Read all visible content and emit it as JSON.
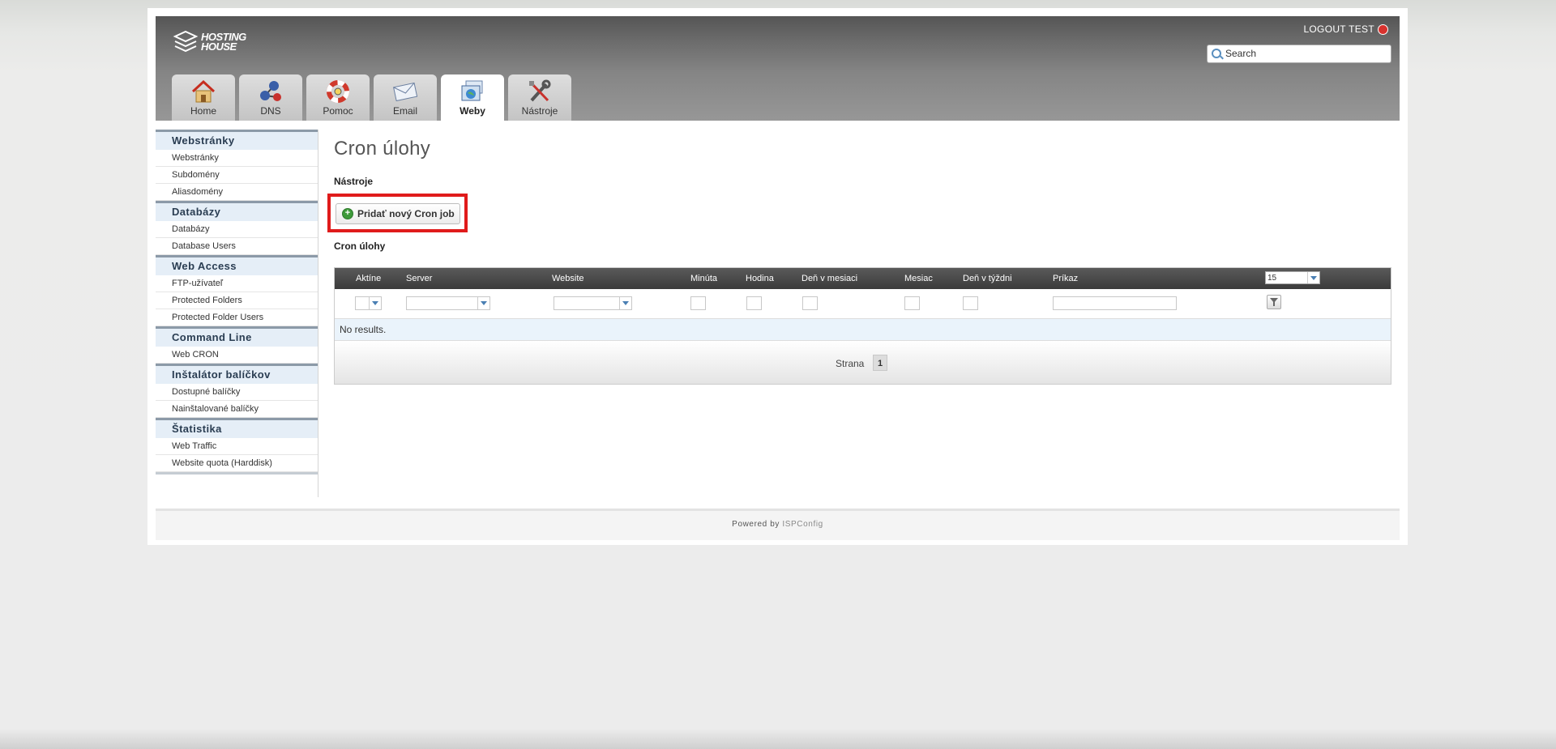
{
  "header": {
    "logo_text_line1": "HOSTING",
    "logo_text_line2": "HOUSE",
    "logout_label": "LOGOUT TEST",
    "search_placeholder": "Search"
  },
  "tabs": [
    {
      "label": "Home",
      "icon": "home-icon"
    },
    {
      "label": "DNS",
      "icon": "dns-icon"
    },
    {
      "label": "Pomoc",
      "icon": "lifebuoy-icon"
    },
    {
      "label": "Email",
      "icon": "envelope-icon"
    },
    {
      "label": "Weby",
      "icon": "globe-icon",
      "active": true
    },
    {
      "label": "Nástroje",
      "icon": "tools-icon"
    }
  ],
  "sidebar": {
    "sections": [
      {
        "title": "Webstránky",
        "items": [
          "Webstránky",
          "Subdomény",
          "Aliasdomény"
        ]
      },
      {
        "title": "Databázy",
        "items": [
          "Databázy",
          "Database Users"
        ]
      },
      {
        "title": "Web Access",
        "items": [
          "FTP-užívateľ",
          "Protected Folders",
          "Protected Folder Users"
        ]
      },
      {
        "title": "Command Line",
        "items": [
          "Web CRON"
        ]
      },
      {
        "title": "Inštalátor balíčkov",
        "items": [
          "Dostupné balíčky",
          "Nainštalované balíčky"
        ]
      },
      {
        "title": "Štatistika",
        "items": [
          "Web Traffic",
          "Website quota (Harddisk)"
        ]
      }
    ]
  },
  "main": {
    "page_title": "Cron úlohy",
    "tools_label": "Nástroje",
    "add_button_label": "Pridať nový Cron job",
    "list_label": "Cron úlohy",
    "columns": [
      "Aktíne",
      "Server",
      "Website",
      "Minúta",
      "Hodina",
      "Deň v mesiaci",
      "Mesiac",
      "Deň v týždni",
      "Príkaz"
    ],
    "per_page": "15",
    "empty_message": "No results.",
    "pager_label": "Strana",
    "current_page": "1"
  },
  "footer": {
    "powered_by": "Powered by",
    "link": "ISPConfig"
  },
  "colors": {
    "highlight": "#e01b1b",
    "sidebar_title_bg": "#e5eef7",
    "grid_header_bg": "#3b3b3b"
  }
}
